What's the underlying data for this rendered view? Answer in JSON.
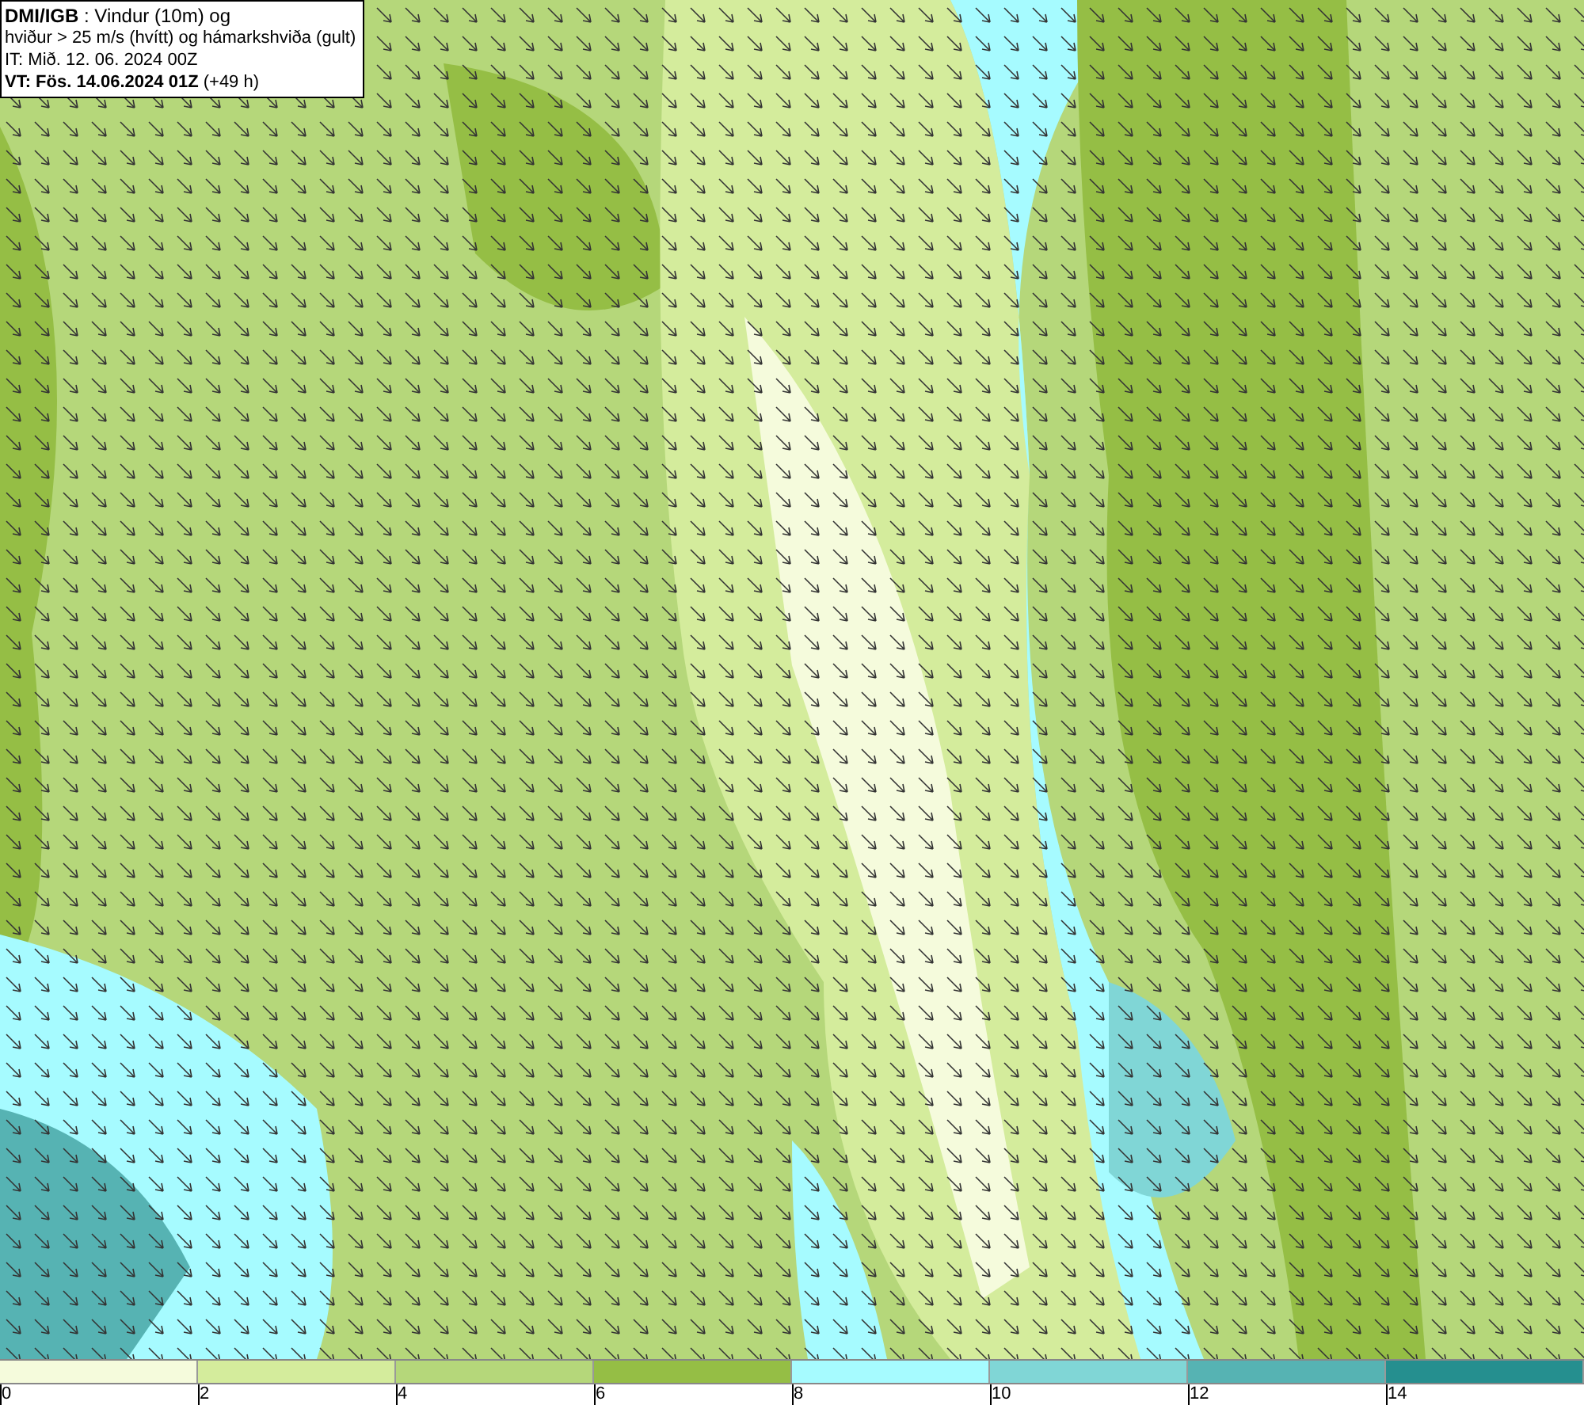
{
  "title_box": {
    "lines": [
      "**DMI/IGB** : Vindur (10m) og",
      "hviður > 25 m/s (hvítt) og hámarkshviða (gult)",
      "IT: Mið. 12. 06. 2024 00Z",
      "**VT: Fös. 14.06.2024 01Z** (+49 h)"
    ]
  },
  "legend": {
    "bins": [
      {
        "color": "#f5fbdc",
        "tick": "0"
      },
      {
        "color": "#d4ec9c",
        "tick": "2"
      },
      {
        "color": "#b5d77a",
        "tick": "4"
      },
      {
        "color": "#95be45",
        "tick": "6"
      },
      {
        "color": "#a6fbff",
        "tick": "8"
      },
      {
        "color": "#80d6d6",
        "tick": "10"
      },
      {
        "color": "#56b3b3",
        "tick": "12"
      },
      {
        "color": "#258f8f",
        "tick": "14"
      }
    ]
  }
}
